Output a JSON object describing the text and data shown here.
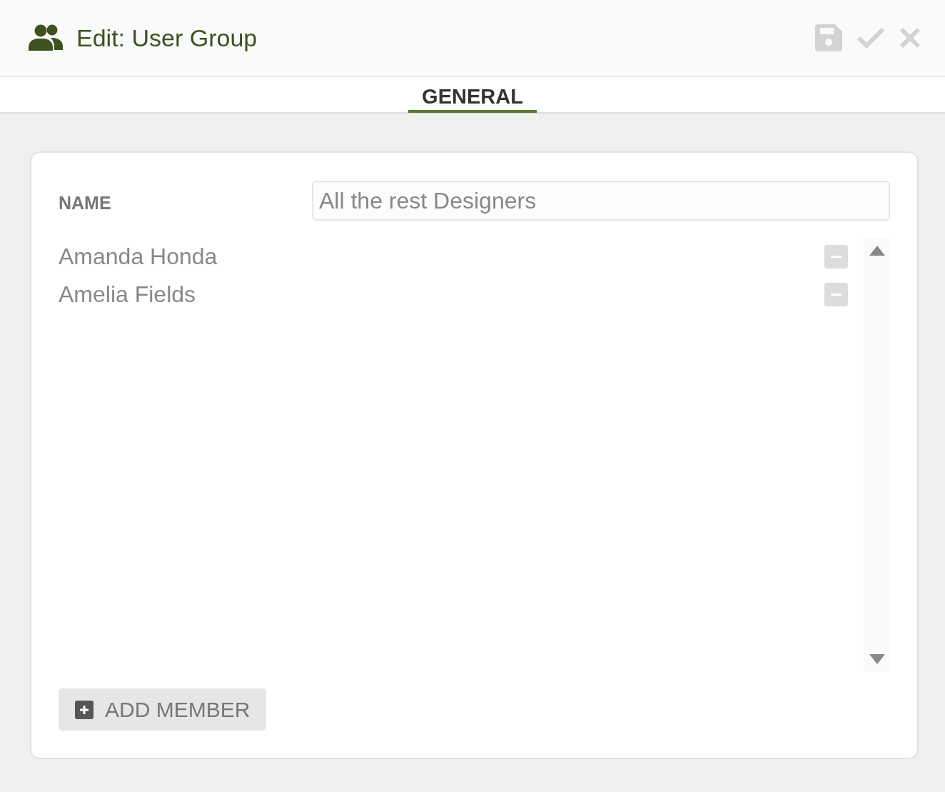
{
  "header": {
    "title": "Edit: User Group"
  },
  "tabs": [
    {
      "label": "GENERAL",
      "selected": true
    }
  ],
  "form": {
    "name_label": "NAME",
    "name_value": "All the rest Designers"
  },
  "members": [
    {
      "name": "Amanda Honda"
    },
    {
      "name": "Amelia Fields"
    }
  ],
  "add_button": {
    "label": "ADD MEMBER"
  }
}
